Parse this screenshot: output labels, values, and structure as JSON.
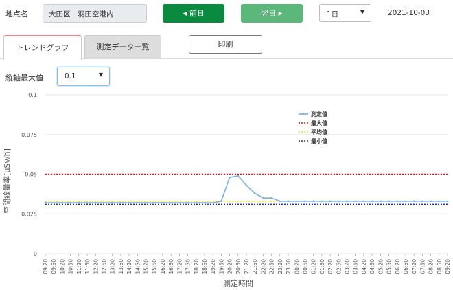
{
  "toolbar": {
    "location_label": "地点名",
    "location_value": "大田区　羽田空港内",
    "prev_label": "前日",
    "next_label": "翌日",
    "range_value": "1日",
    "date": "2021-10-03"
  },
  "tabs": {
    "trend_label": "トレンドグラフ",
    "list_label": "測定データ一覧",
    "print_label": "印刷"
  },
  "ymax": {
    "label": "縦軸最大値",
    "value": "0.1"
  },
  "colors": {
    "prev_button": "#0a8a3f",
    "next_button": "#5cb87a",
    "measured": "#7ab2e0",
    "max": "#d11a1a",
    "avg": "#f2e600",
    "min": "#1f2ea8"
  },
  "chart_data": {
    "type": "line",
    "xlabel": "測定時間",
    "ylabel": "空間線量率[μSv/h]",
    "ylim": [
      0,
      0.1
    ],
    "yticks": [
      0,
      0.025,
      0.05,
      0.075,
      0.1
    ],
    "ytick_labels": [
      "0",
      "0.025",
      "0.05",
      "0.075",
      "0.1"
    ],
    "grid": true,
    "legend_position": "top-right",
    "x": [
      "09:20",
      "09:50",
      "10:20",
      "10:50",
      "11:20",
      "11:50",
      "12:20",
      "12:50",
      "13:20",
      "13:50",
      "14:20",
      "14:50",
      "15:20",
      "15:50",
      "16:20",
      "16:50",
      "17:20",
      "17:50",
      "18:20",
      "18:50",
      "19:20",
      "19:50",
      "20:20",
      "20:50",
      "21:20",
      "21:50",
      "22:20",
      "22:50",
      "23:20",
      "23:50",
      "00:20",
      "00:50",
      "01:20",
      "01:50",
      "02:20",
      "02:50",
      "03:20",
      "03:50",
      "04:20",
      "04:50",
      "05:20",
      "05:50",
      "06:20",
      "06:50",
      "07:20",
      "07:50",
      "08:20",
      "08:50",
      "09:20"
    ],
    "series": [
      {
        "name": "測定値",
        "values": [
          0.032,
          0.032,
          0.032,
          0.032,
          0.032,
          0.032,
          0.032,
          0.032,
          0.032,
          0.032,
          0.032,
          0.032,
          0.032,
          0.032,
          0.032,
          0.032,
          0.032,
          0.032,
          0.032,
          0.032,
          0.032,
          0.033,
          0.048,
          0.049,
          0.043,
          0.038,
          0.035,
          0.035,
          0.033,
          0.033,
          0.033,
          0.033,
          0.033,
          0.033,
          0.033,
          0.033,
          0.033,
          0.033,
          0.033,
          0.033,
          0.033,
          0.033,
          0.033,
          0.033,
          0.033,
          0.033,
          0.033,
          0.033,
          0.033
        ]
      },
      {
        "name": "最大値",
        "constant": 0.05
      },
      {
        "name": "平均値",
        "constant": 0.033
      },
      {
        "name": "最小値",
        "constant": 0.031
      }
    ]
  }
}
